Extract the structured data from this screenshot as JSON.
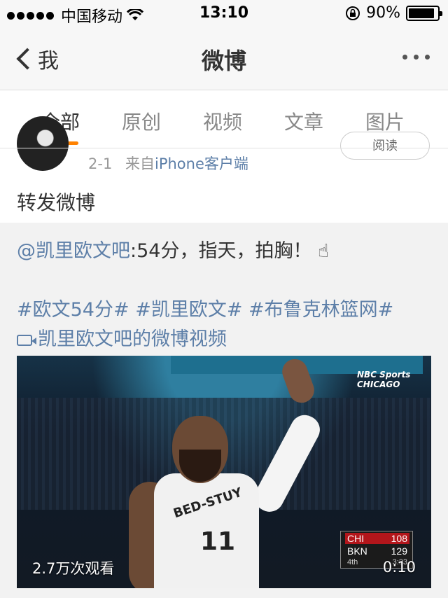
{
  "status_bar": {
    "carrier": "中国移动",
    "time": "13:10",
    "battery": "90%",
    "battery_level": 0.9
  },
  "nav": {
    "back_label": "我",
    "title": "微博"
  },
  "tabs": [
    {
      "label": "全部",
      "active": true
    },
    {
      "label": "原创",
      "active": false
    },
    {
      "label": "视频",
      "active": false
    },
    {
      "label": "文章",
      "active": false
    },
    {
      "label": "图片",
      "active": false
    }
  ],
  "post": {
    "date": "2-1",
    "source_prefix": "来自",
    "source": "iPhone客户端",
    "read_button": "阅读",
    "text": "转发微博"
  },
  "quoted": {
    "author": "@凯里欧文吧",
    "text": ":54分，指天，拍胸！",
    "emoji": "☝",
    "hashtags": [
      "#欧文54分#",
      "#凯里欧文#",
      "#布鲁克林篮网#"
    ],
    "video_link": "凯里欧文吧的微博视频"
  },
  "video": {
    "views": "2.7万次观看",
    "duration": "0:10",
    "broadcaster": "NBC Sports CHICAGO",
    "jersey_name": "BED-STUY",
    "jersey_number": "11",
    "score": {
      "team1": "CHI",
      "score1": "108",
      "team2": "BKN",
      "score2": "129",
      "period": "4th",
      "clock": "3:33"
    }
  },
  "colors": {
    "accent": "#ff8200",
    "link": "#5d7fa8",
    "nav_bg": "#f7f7f7",
    "quote_bg": "#f2f2f2"
  }
}
